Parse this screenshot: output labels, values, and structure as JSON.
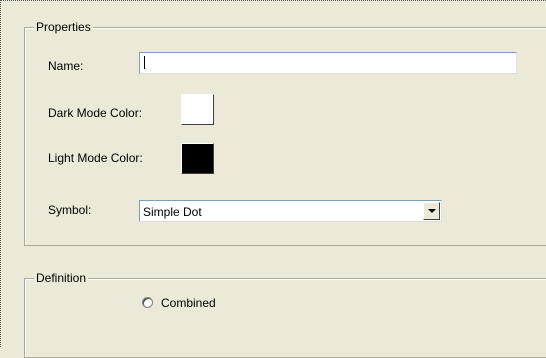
{
  "properties": {
    "legend": "Properties",
    "name_label": "Name:",
    "name_value": "",
    "dark_mode_label": "Dark Mode Color:",
    "dark_mode_color": "#ffffff",
    "light_mode_label": "Light Mode Color:",
    "light_mode_color": "#000000",
    "symbol_label": "Symbol:",
    "symbol_value": "Simple Dot"
  },
  "definition": {
    "legend": "Definition",
    "combined_label": "Combined",
    "combined_checked": false
  }
}
